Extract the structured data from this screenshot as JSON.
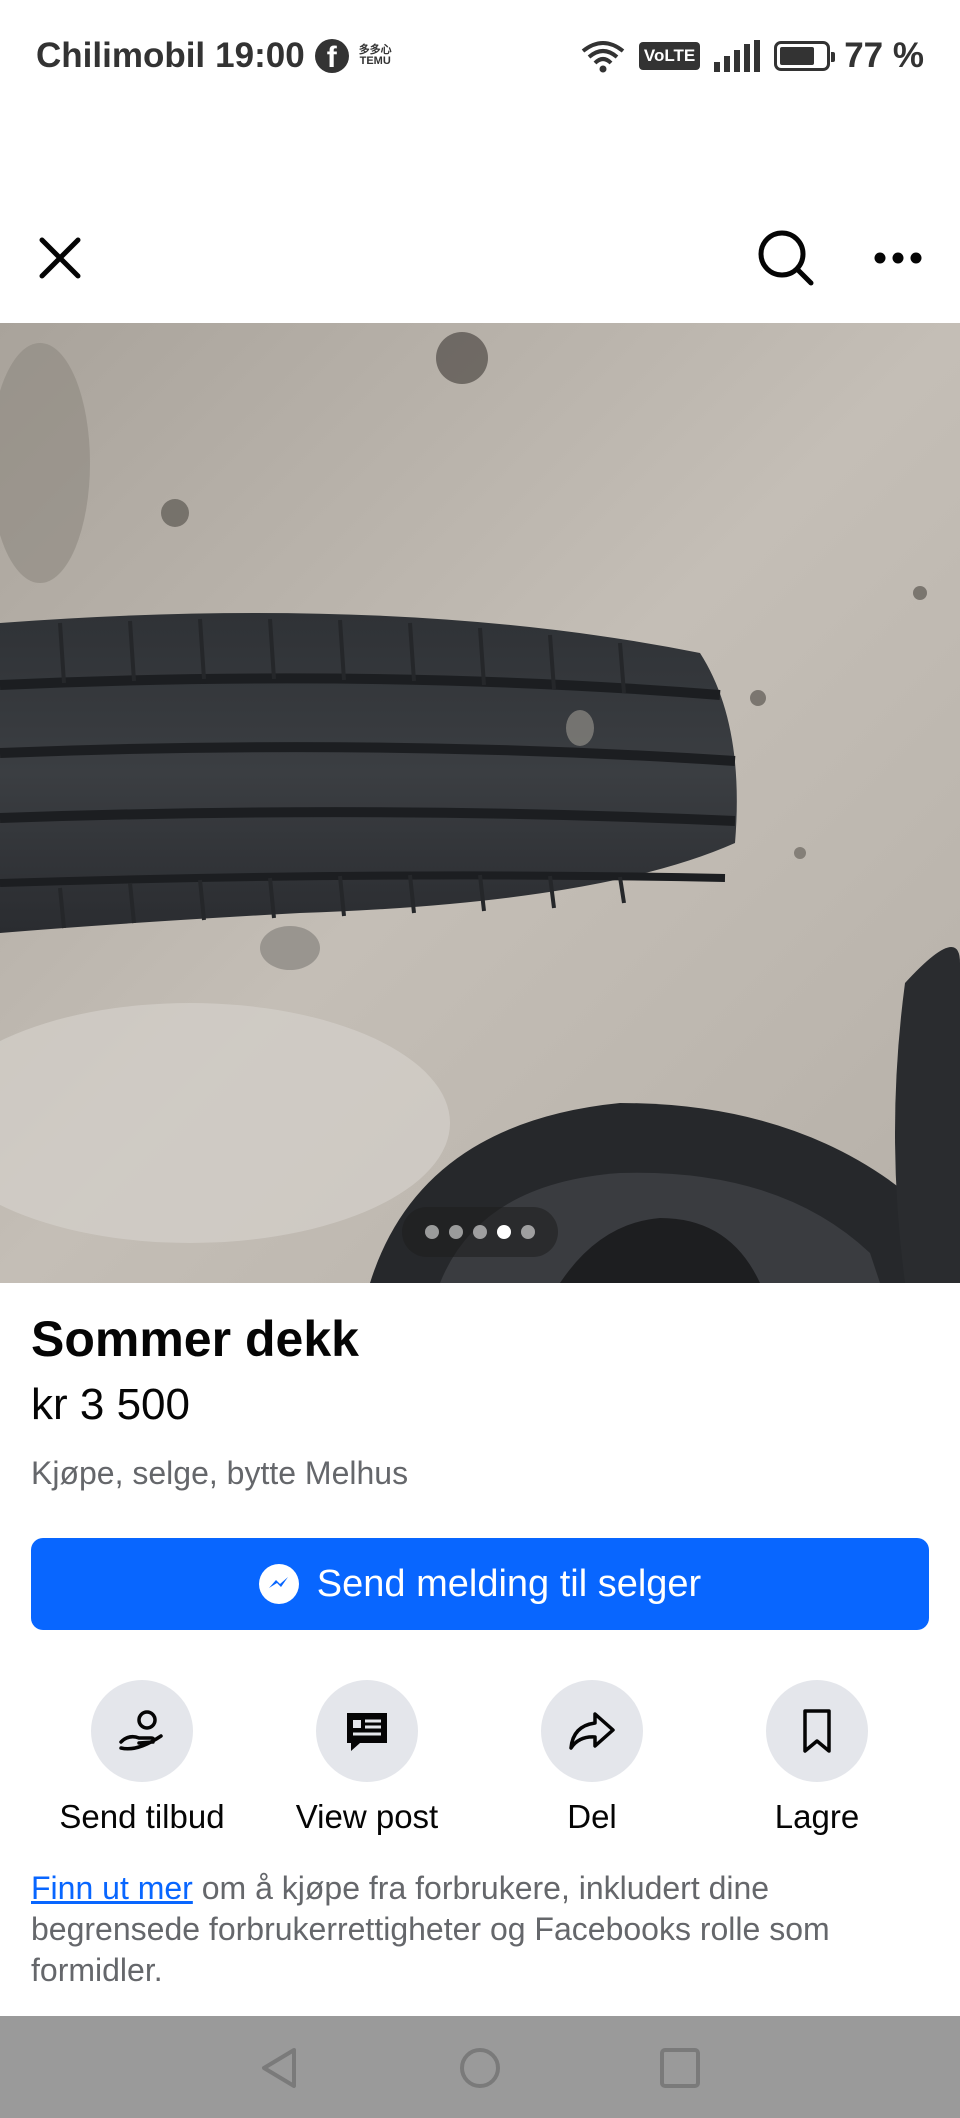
{
  "status_bar": {
    "carrier": "Chilimobil",
    "time": "19:00",
    "notification_icons": [
      "facebook-icon",
      "temu-icon"
    ],
    "temu_line1": "多多心",
    "temu_line2": "TEMU",
    "volte": "VoLTE",
    "battery_percent": "77 %",
    "battery_level": 0.77
  },
  "top_nav": {
    "close_icon": "close-icon",
    "search_icon": "search-icon",
    "more_icon": "more-icon"
  },
  "photo": {
    "description_icon": "listing-photo",
    "carousel_count": 5,
    "carousel_active": 4
  },
  "listing": {
    "title": "Sommer dekk",
    "price": "kr 3 500",
    "location": "Kjøpe, selge, bytte Melhus"
  },
  "message_button": {
    "label": "Send melding til selger",
    "icon": "messenger-icon"
  },
  "actions": [
    {
      "label": "Send tilbud",
      "icon": "offer-icon"
    },
    {
      "label": "View post",
      "icon": "post-icon"
    },
    {
      "label": "Del",
      "icon": "share-icon"
    },
    {
      "label": "Lagre",
      "icon": "bookmark-icon"
    }
  ],
  "info": {
    "link": "Finn ut mer",
    "text": " om å kjøpe fra forbrukere, inkludert dine begrensede forbrukerrettigheter og Facebooks rolle som formidler."
  },
  "colors": {
    "accent": "#0866ff",
    "secondary_text": "#65676b",
    "action_bg": "#e4e6eb"
  }
}
